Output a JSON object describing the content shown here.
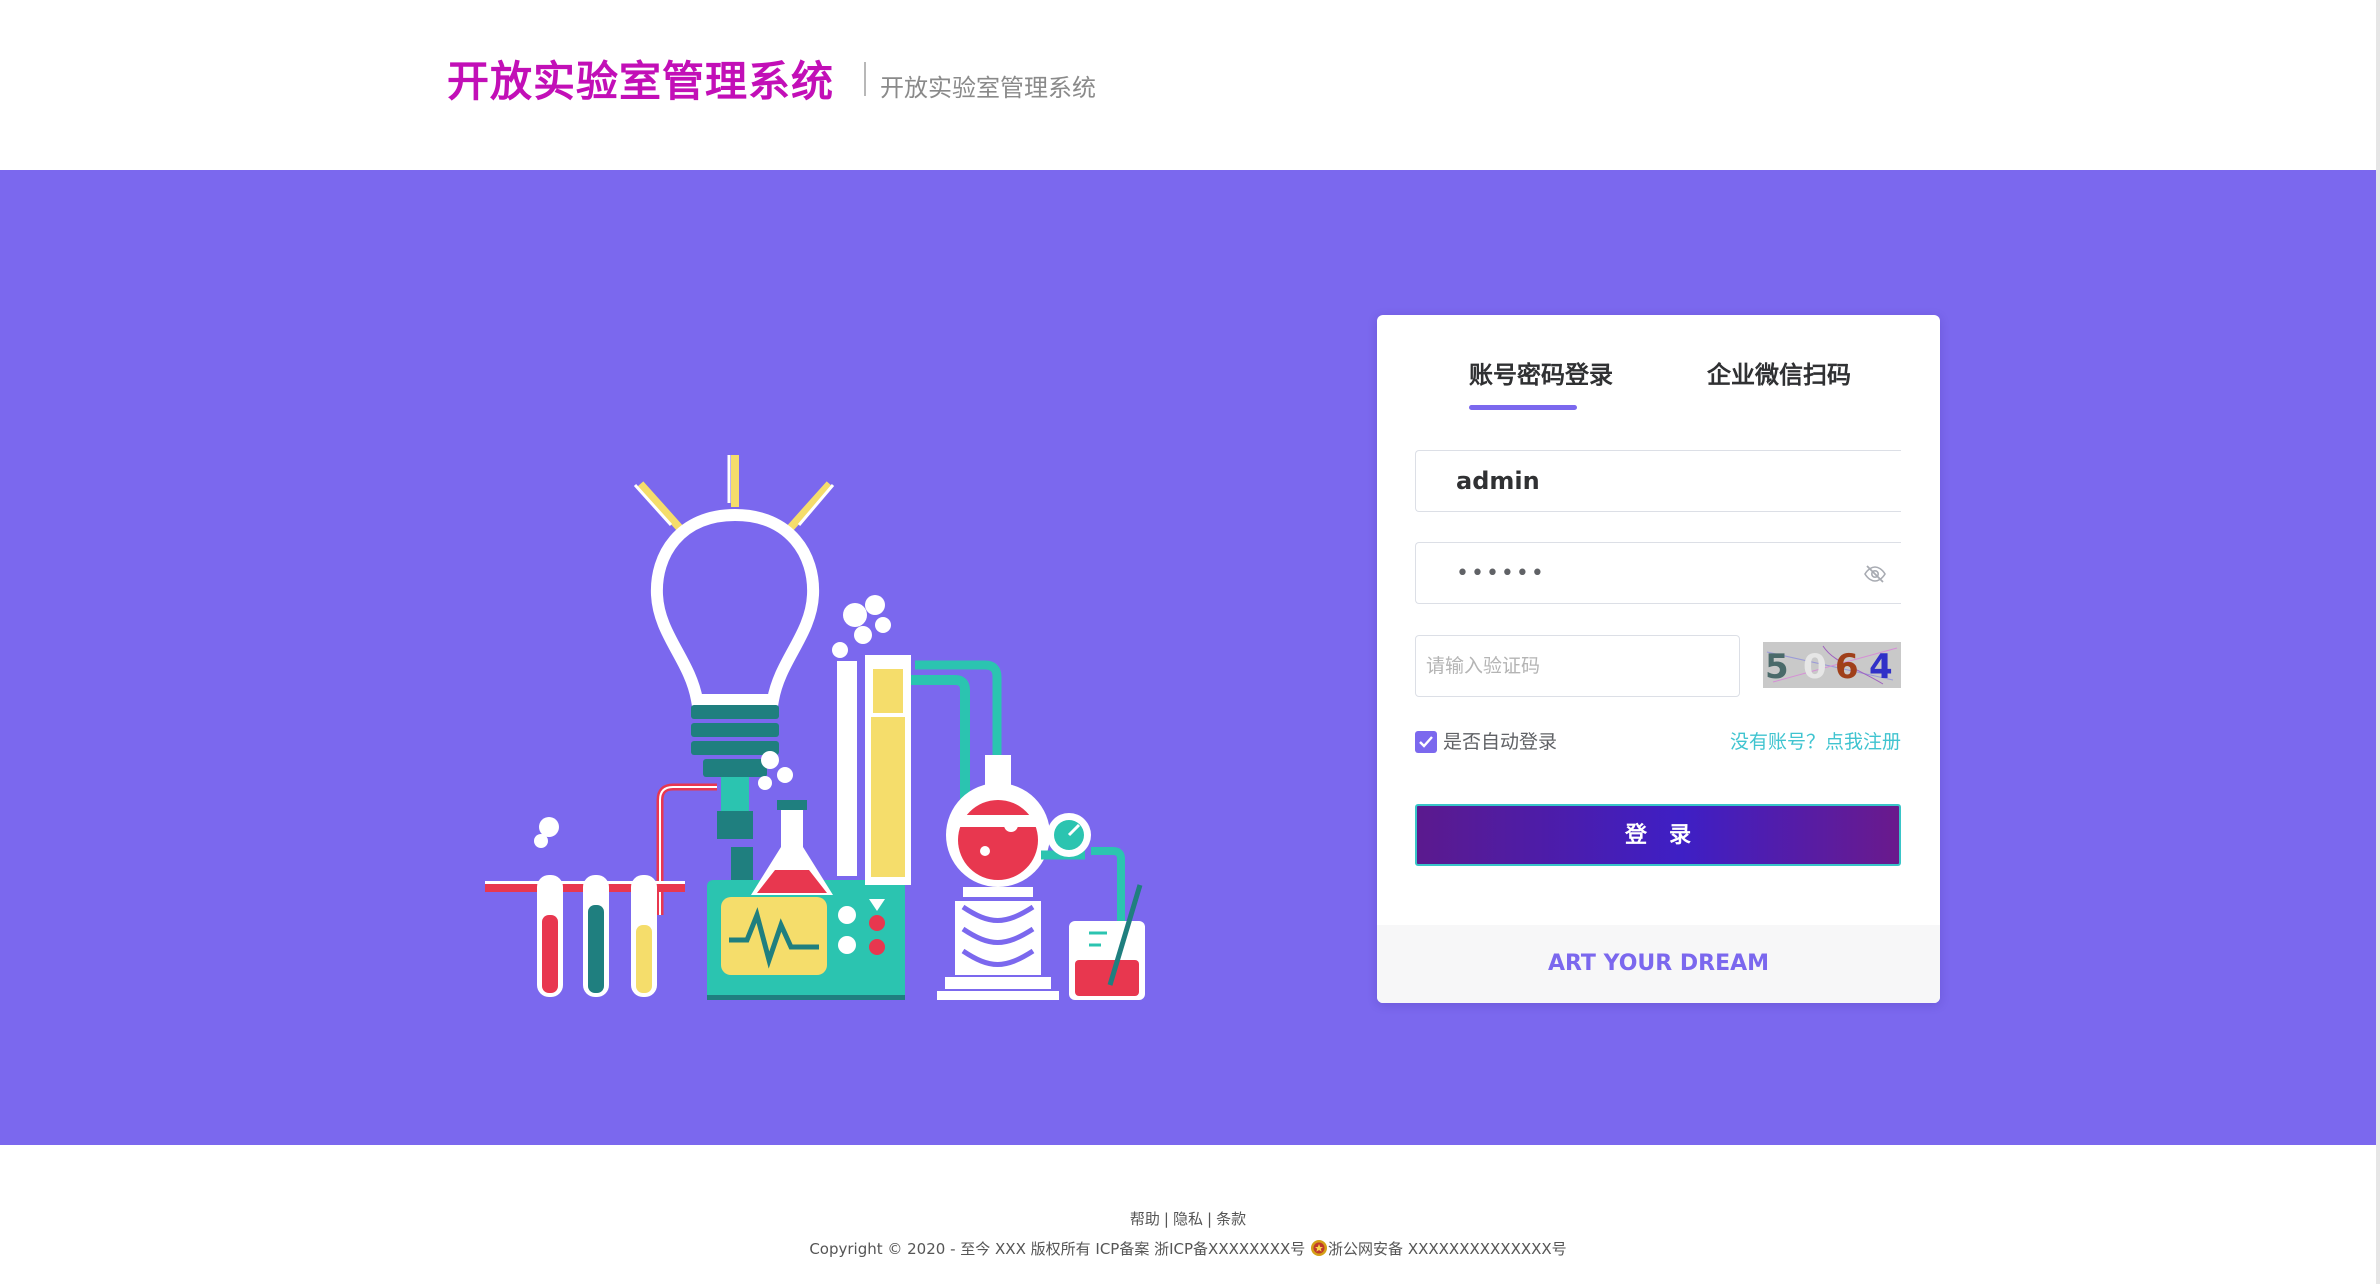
{
  "header": {
    "title": "开放实验室管理系统",
    "subtitle": "开放实验室管理系统"
  },
  "login": {
    "tabs": [
      {
        "label": "账号密码登录",
        "active": true
      },
      {
        "label": "企业微信扫码",
        "active": false
      }
    ],
    "username": {
      "value": "admin"
    },
    "password": {
      "value": "••••••"
    },
    "captcha": {
      "value": "",
      "placeholder": "请输入验证码",
      "image_text": [
        "5",
        "0",
        "6",
        "4"
      ]
    },
    "remember_label": "是否自动登录",
    "remember_checked": true,
    "register_link": "没有账号？点我注册",
    "submit_label": "登录",
    "slogan": "ART YOUR DREAM"
  },
  "footer": {
    "links": [
      "帮助",
      "隐私",
      "条款"
    ],
    "copyright_text": "Copyright © 2020 - 至今 XXX 版权所有 ICP备案 浙ICP备XXXXXXXX号",
    "police_text": "浙公网安备 XXXXXXXXXXXXXX号"
  },
  "colors": {
    "brand_title": "#c20fb7",
    "banner_background": "#7b68ee",
    "accent": "#7b68ee",
    "link": "#40c4d0",
    "button_start": "#5b1a8e",
    "button_mid": "#3e1fc5",
    "button_border": "#39c5c8"
  },
  "icons": {
    "password_toggle": "eye-off-icon",
    "checkbox_mark": "check-icon",
    "police_badge": "police-badge-icon"
  }
}
